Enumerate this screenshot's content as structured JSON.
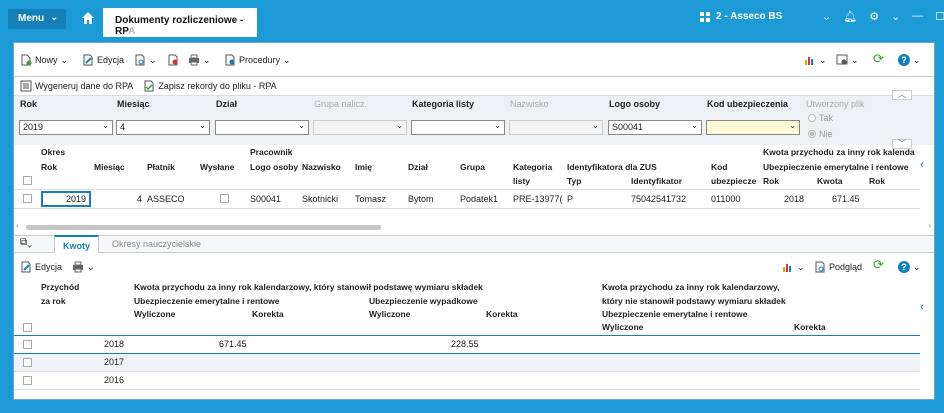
{
  "titlebar": {
    "menu_label": "Menu",
    "tab_title": "Dokumenty rozliczeniowe - RP",
    "tab_title_faded": "A",
    "company": "2 - Asseco BS"
  },
  "toolbar": {
    "nowy": "Nowy",
    "edycja": "Edycja",
    "procedury": "Procedury",
    "wygeneruj": "Wygeneruj dane do RPA",
    "zapisz": "Zapisz rekordy do pliku - RPA"
  },
  "filters": {
    "labels": {
      "rok": "Rok",
      "miesiac": "Miesiąc",
      "dzial": "Dział",
      "grupa": "Grupa nalicz.",
      "kategoria": "Kategoria listy",
      "nazwisko": "Nazwisko",
      "logo": "Logo osoby",
      "kod": "Kod ubezpieczenia",
      "utworzony": "Utworzony plik"
    },
    "values": {
      "rok": "2019",
      "miesiac": "4",
      "logo": "S00041"
    },
    "radio_tak": "Tak",
    "radio_nie": "Nie"
  },
  "grid1": {
    "group_headers": {
      "okres": "Okres",
      "pracownik": "Pracownik",
      "kwota": "Kwota przychodu za inny rok kalenda"
    },
    "sub_headers": {
      "zus": "Identyfikatora dla ZUS",
      "ubezp": "Ubezpieczenie emerytalne i rentowe"
    },
    "columns": [
      "Rok",
      "Miesiąc",
      "Płatnik",
      "Wysłane",
      "Logo osoby",
      "Nazwisko",
      "Imię",
      "Dział",
      "Grupa",
      "Kategoria",
      "Typ",
      "Identyfikator",
      "Kod",
      "Rok",
      "Kwota",
      "Rok"
    ],
    "col_kategoria_2": "listy",
    "col_kod_2": "ubezpiecze",
    "row": {
      "rok": "2019",
      "miesiac": "4",
      "platnik": "ASSECO",
      "logo": "S00041",
      "nazwisko": "Skotnicki",
      "imie": "Tomasz",
      "dzial": "Bytom",
      "grupa": "Podatek1",
      "kategoria": "PRE-13977(",
      "typ": "P",
      "identyfikator": "75042541732",
      "kod": "011000",
      "rok2": "2018",
      "kwota": "671.45"
    }
  },
  "lower": {
    "tabs": {
      "kwoty": "Kwoty",
      "okresy": "Okresy nauczycielskie"
    },
    "edycja": "Edycja",
    "podglad": "Podgląd",
    "headers": {
      "przychod": "Przychód",
      "za_rok": "za rok",
      "kwota1": "Kwota przychodu za inny rok kalendarzowy, który stanowił podstawę wymiaru składek",
      "emeryt": "Ubezpieczenie emerytalne i rentowe",
      "wypadek": "Ubezpieczenie wypadkowe",
      "wyliczone": "Wyliczone",
      "korekta": "Korekta",
      "kwota2a": "Kwota przychodu za inny rok kalendarzowy,",
      "kwota2b": "który nie stanowił podstawy wymiaru składek"
    },
    "rows": [
      {
        "rok": "2018",
        "emeryt": "671.45",
        "wypadek": "228.55"
      },
      {
        "rok": "2017",
        "emeryt": "",
        "wypadek": ""
      },
      {
        "rok": "2016",
        "emeryt": "",
        "wypadek": ""
      }
    ]
  }
}
